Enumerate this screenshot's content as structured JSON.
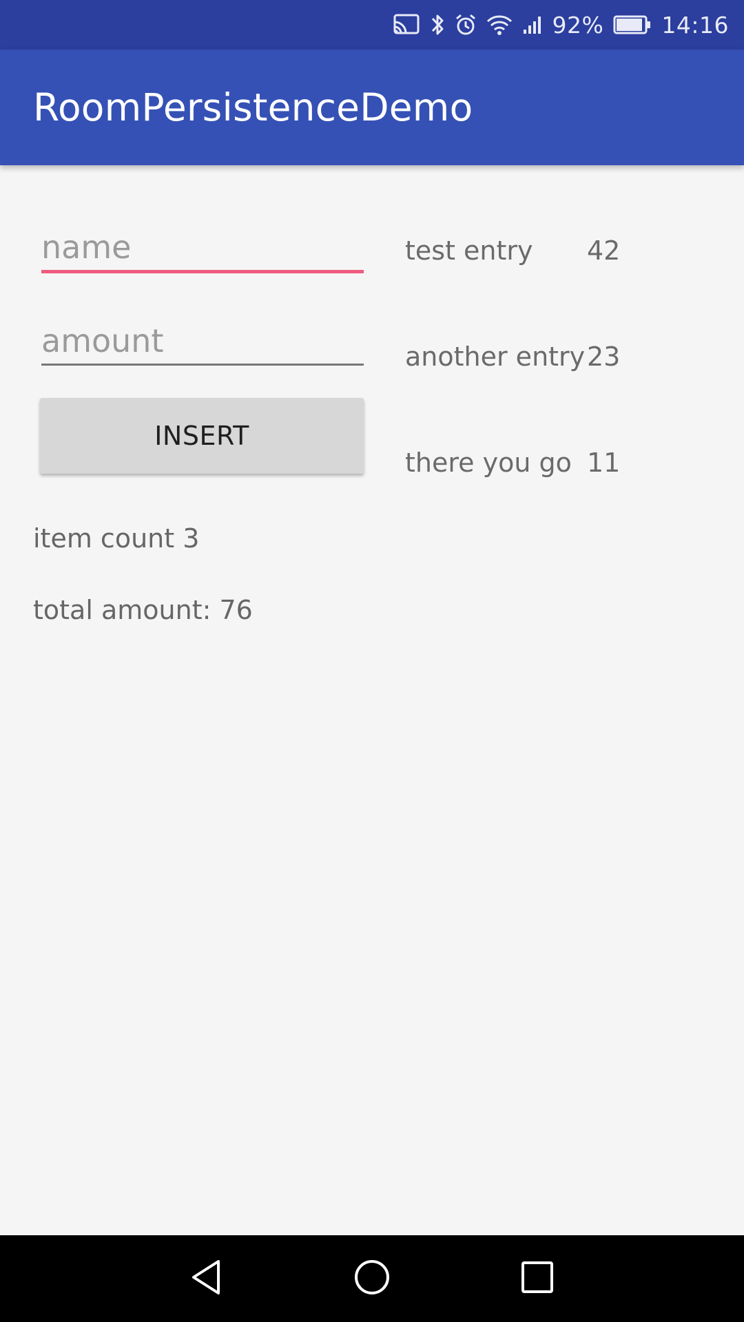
{
  "status_bar": {
    "battery_percent": "92%",
    "time": "14:16",
    "icons": [
      "cast-icon",
      "bluetooth-icon",
      "alarm-icon",
      "wifi-icon",
      "signal-icon",
      "battery-icon"
    ],
    "battery_level": 0.92,
    "color": "#2c3e9e"
  },
  "app_bar": {
    "title": "RoomPersistenceDemo",
    "color": "#3551b5"
  },
  "form": {
    "name_placeholder": "name",
    "name_value": "",
    "amount_placeholder": "amount",
    "amount_value": "",
    "insert_label": "INSERT",
    "focus_color": "#f05a7e"
  },
  "summary": {
    "item_count": "item count 3",
    "total_amount": "total amount: 76"
  },
  "entries": [
    {
      "name": "test entry",
      "amount": "42"
    },
    {
      "name": "another entry",
      "amount": "23"
    },
    {
      "name": "there you go",
      "amount": "11"
    }
  ],
  "nav_bar": {
    "icons": [
      "back-icon",
      "home-icon",
      "recents-icon"
    ]
  }
}
